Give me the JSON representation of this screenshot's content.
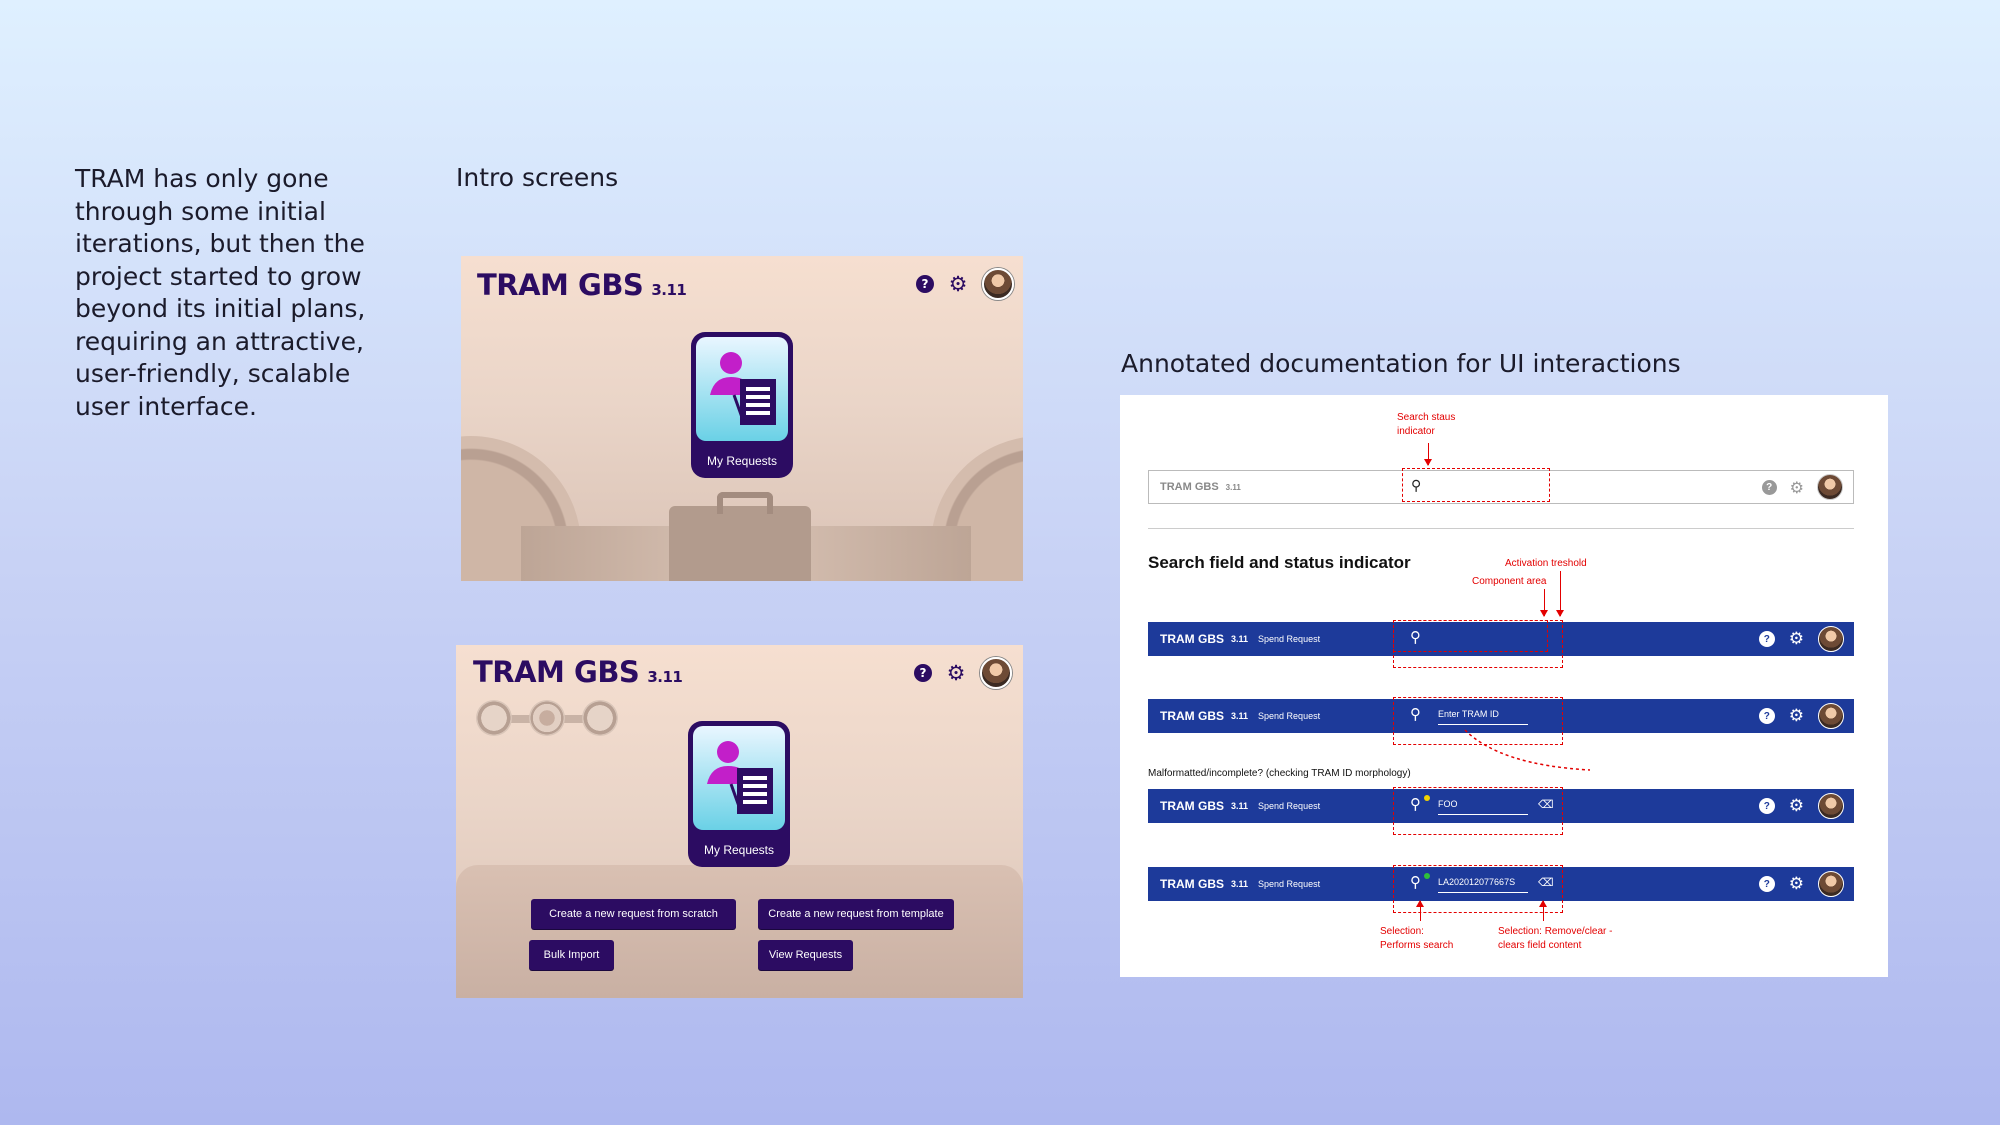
{
  "intro_text": "TRAM has only gone through some initial iterations, but then the project started to grow beyond its initial plans, requiring an attractive, user-friendly, scalable user interface.",
  "headings": {
    "intro_screens": "Intro screens",
    "annotated_doc": "Annotated documentation for UI interactions"
  },
  "app": {
    "name": "TRAM GBS",
    "version": "3.11",
    "subtitle": "Spend Request",
    "help_glyph": "?",
    "gear_glyph": "⚙",
    "search_glyph": "⚲"
  },
  "screen1": {
    "tile_label": "My Requests"
  },
  "screen2": {
    "tile_label": "My Requests",
    "buttons": {
      "scratch": "Create a new request from scratch",
      "template": "Create a new request from template",
      "bulk": "Bulk Import",
      "view": "View Requests"
    }
  },
  "doc": {
    "section_title": "Search field and status indicator",
    "annotations": {
      "search_status": "Search staus\nindicator",
      "activation": "Activation treshold",
      "component_area": "Component area",
      "malformatted": "Malformatted/incomplete? (checking TRAM ID  morphology)",
      "sel_search": "Selection:\nPerforms search",
      "sel_clear": "Selection: Remove/clear -\nclears field content"
    },
    "fields": {
      "placeholder": "Enter TRAM ID",
      "value_foo": "FOO",
      "value_id": "LA202012077667S"
    },
    "clear_glyph": "⌫",
    "colors": {
      "bar": "#1d3a9a",
      "annotation": "#e30000",
      "status_yellow": "#f2d200",
      "status_green": "#2fbf3a"
    }
  },
  "colors": {
    "brand": "#2c0c62"
  }
}
